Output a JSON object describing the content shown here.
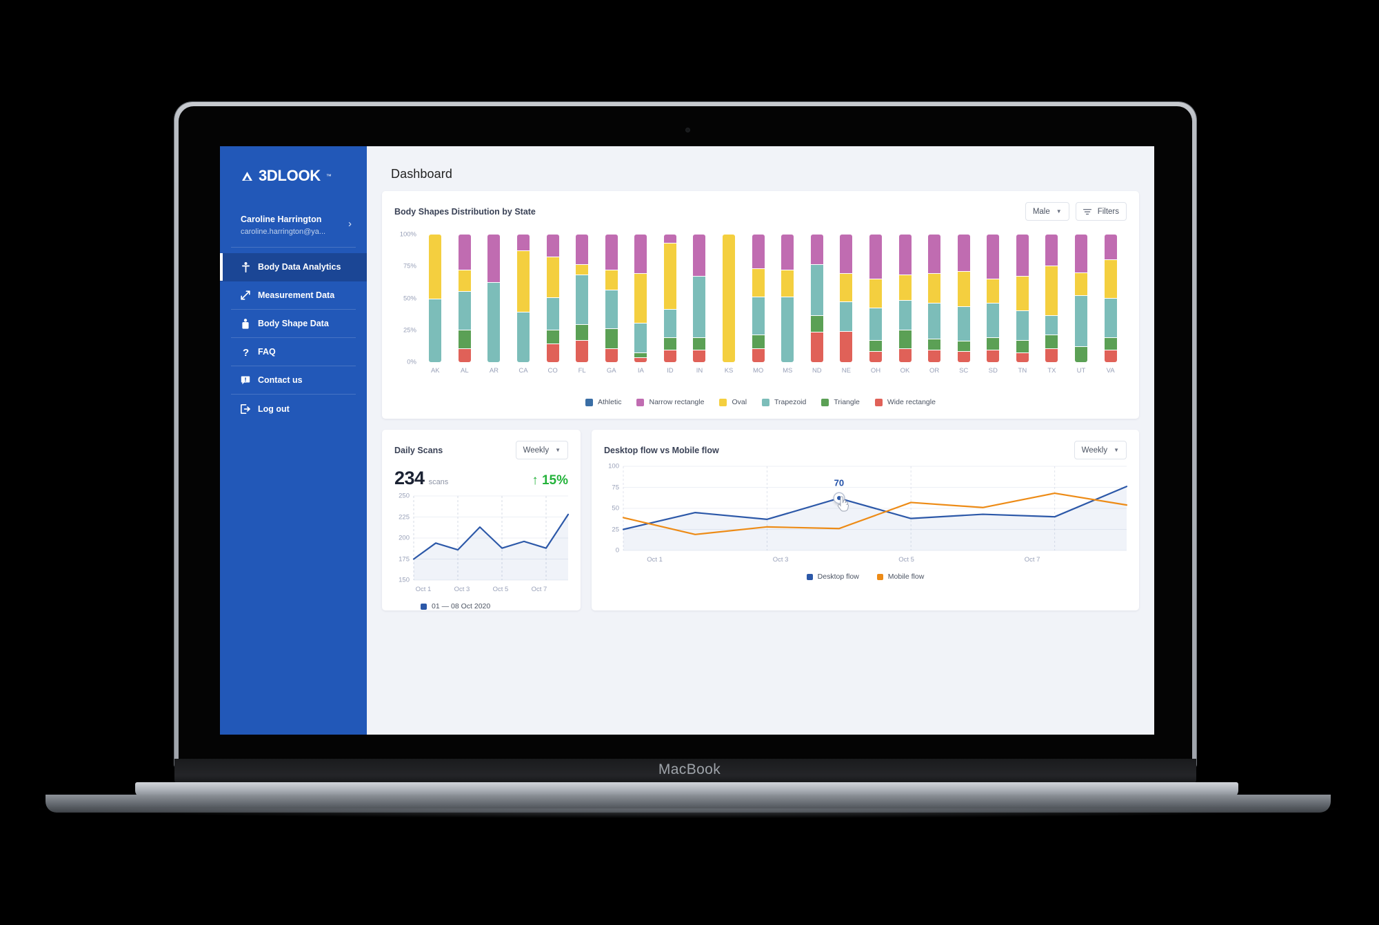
{
  "device": {
    "brand_label": "MacBook"
  },
  "brand": {
    "logo_text": "3DLOOK",
    "logo_tm": "™"
  },
  "colors": {
    "sidebar_bg": "#2258b8",
    "sidebar_active_bg": "#1b4695",
    "accent_blue": "#2c58a8",
    "accent_orange": "#ed8b16",
    "delta_green": "#23b23a",
    "athletic": "#3a6ea5",
    "narrow_rectangle": "#c06cb1",
    "oval": "#f4cf3f",
    "trapezoid": "#7cbdb9",
    "triangle": "#5ba055",
    "wide_rectangle": "#e06158"
  },
  "sidebar": {
    "user": {
      "name": "Caroline Harrington",
      "email": "caroline.harrington@ya...",
      "chevron": "›"
    },
    "items": [
      {
        "label": "Body Data Analytics",
        "icon": "body-person-icon",
        "active": true
      },
      {
        "label": "Measurement Data",
        "icon": "measure-arrows-icon",
        "active": false
      },
      {
        "label": "Body Shape Data",
        "icon": "torso-icon",
        "active": false
      },
      {
        "label": "FAQ",
        "icon": "question-mark-icon",
        "active": false
      },
      {
        "label": "Contact us",
        "icon": "chat-bubble-icon",
        "active": false
      },
      {
        "label": "Log out",
        "icon": "logout-icon",
        "active": false
      }
    ]
  },
  "header": {
    "page_title": "Dashboard"
  },
  "bar_card": {
    "title": "Body Shapes Distribution by State",
    "gender_select": {
      "value": "Male",
      "caret": "▼"
    },
    "filters_button": "Filters"
  },
  "scans_card": {
    "title": "Daily Scans",
    "period_select": {
      "value": "Weekly",
      "caret": "▼"
    },
    "value": "234",
    "unit": "scans",
    "delta": "↑ 15%",
    "legend": [
      {
        "label": "01 — 08 Oct 2020",
        "color": "#2c58a8"
      }
    ]
  },
  "flow_card": {
    "title": "Desktop flow vs Mobile flow",
    "period_select": {
      "value": "Weekly",
      "caret": "▼"
    },
    "tooltip_value": "70",
    "legend": [
      {
        "label": "Desktop flow",
        "color": "#2c58a8"
      },
      {
        "label": "Mobile flow",
        "color": "#ed8b16"
      }
    ]
  },
  "chart_data": [
    {
      "type": "bar",
      "id": "body-shapes-distribution-by-state",
      "title": "Body Shapes Distribution by State",
      "stacked": true,
      "stack_mode": "percent",
      "xlabel": "",
      "ylabel": "",
      "ylim": [
        0,
        100
      ],
      "yticks": [
        "0%",
        "25%",
        "50%",
        "75%",
        "100%"
      ],
      "grid": false,
      "legend_position": "bottom",
      "categories": [
        "AK",
        "AL",
        "AR",
        "CA",
        "CO",
        "FL",
        "GA",
        "IA",
        "ID",
        "IN",
        "KS",
        "MO",
        "MS",
        "ND",
        "NE",
        "OH",
        "OK",
        "OR",
        "SC",
        "SD",
        "TN",
        "TX",
        "UT",
        "VA"
      ],
      "series": [
        {
          "name": "Wide rectangle",
          "color": "#e06158",
          "values": [
            0,
            10,
            0,
            0,
            14,
            17,
            10,
            3,
            9,
            9,
            0,
            10,
            0,
            23,
            24,
            8,
            10,
            9,
            8,
            9,
            7,
            10,
            0,
            9
          ]
        },
        {
          "name": "Triangle",
          "color": "#5ba055",
          "values": [
            0,
            15,
            0,
            0,
            11,
            12,
            16,
            4,
            10,
            10,
            0,
            11,
            0,
            13,
            0,
            9,
            15,
            9,
            8,
            10,
            10,
            11,
            12,
            10
          ]
        },
        {
          "name": "Trapezoid",
          "color": "#7cbdb9",
          "values": [
            49,
            30,
            62,
            39,
            25,
            39,
            30,
            23,
            22,
            48,
            0,
            30,
            51,
            40,
            23,
            25,
            23,
            28,
            27,
            27,
            23,
            15,
            40,
            31
          ]
        },
        {
          "name": "Oval",
          "color": "#f4cf3f",
          "values": [
            51,
            17,
            0,
            48,
            32,
            8,
            16,
            39,
            52,
            0,
            100,
            22,
            21,
            0,
            22,
            23,
            20,
            23,
            28,
            19,
            27,
            39,
            18,
            30
          ]
        },
        {
          "name": "Narrow rectangle",
          "color": "#c06cb1",
          "values": [
            0,
            28,
            38,
            13,
            18,
            24,
            28,
            31,
            7,
            33,
            0,
            27,
            28,
            24,
            31,
            35,
            32,
            31,
            29,
            35,
            33,
            25,
            30,
            20
          ]
        },
        {
          "name": "Athletic",
          "color": "#3a6ea5",
          "values": [
            0,
            0,
            0,
            0,
            0,
            0,
            0,
            0,
            0,
            0,
            0,
            0,
            0,
            0,
            0,
            0,
            0,
            0,
            0,
            0,
            0,
            0,
            0,
            0
          ]
        }
      ]
    },
    {
      "type": "area",
      "id": "daily-scans",
      "title": "Daily Scans",
      "xlabel": "",
      "ylabel": "",
      "ylim": [
        150,
        250
      ],
      "yticks": [
        "150",
        "175",
        "200",
        "225",
        "250"
      ],
      "x": [
        "Oct 1",
        "",
        "Oct 3",
        "",
        "Oct 5",
        "",
        "Oct 7",
        ""
      ],
      "xtick_labels": [
        "Oct 1",
        "Oct 3",
        "Oct 5",
        "Oct 7"
      ],
      "grid": true,
      "legend_position": "bottom",
      "series": [
        {
          "name": "01 — 08 Oct 2020",
          "color": "#2c58a8",
          "values": [
            175,
            194,
            186,
            213,
            188,
            196,
            188,
            228
          ]
        }
      ]
    },
    {
      "type": "line",
      "id": "desktop-flow-vs-mobile-flow",
      "title": "Desktop flow vs Mobile flow",
      "xlabel": "",
      "ylabel": "",
      "ylim": [
        0,
        100
      ],
      "yticks": [
        "0",
        "25",
        "50",
        "75",
        "100"
      ],
      "x": [
        "Oct 1",
        "",
        "Oct 3",
        "",
        "Oct 5",
        "",
        "Oct 7",
        ""
      ],
      "xtick_labels": [
        "Oct 1",
        "Oct 3",
        "Oct 5",
        "Oct 7"
      ],
      "grid": true,
      "legend_position": "bottom",
      "annotation": {
        "label": "70",
        "series": "Desktop flow",
        "x_index": 3,
        "value": 62
      },
      "series": [
        {
          "name": "Desktop flow",
          "color": "#2c58a8",
          "values": [
            25,
            45,
            37,
            62,
            38,
            43,
            40,
            76
          ]
        },
        {
          "name": "Mobile flow",
          "color": "#ed8b16",
          "values": [
            39,
            19,
            28,
            26,
            57,
            51,
            68,
            54
          ]
        }
      ]
    }
  ]
}
